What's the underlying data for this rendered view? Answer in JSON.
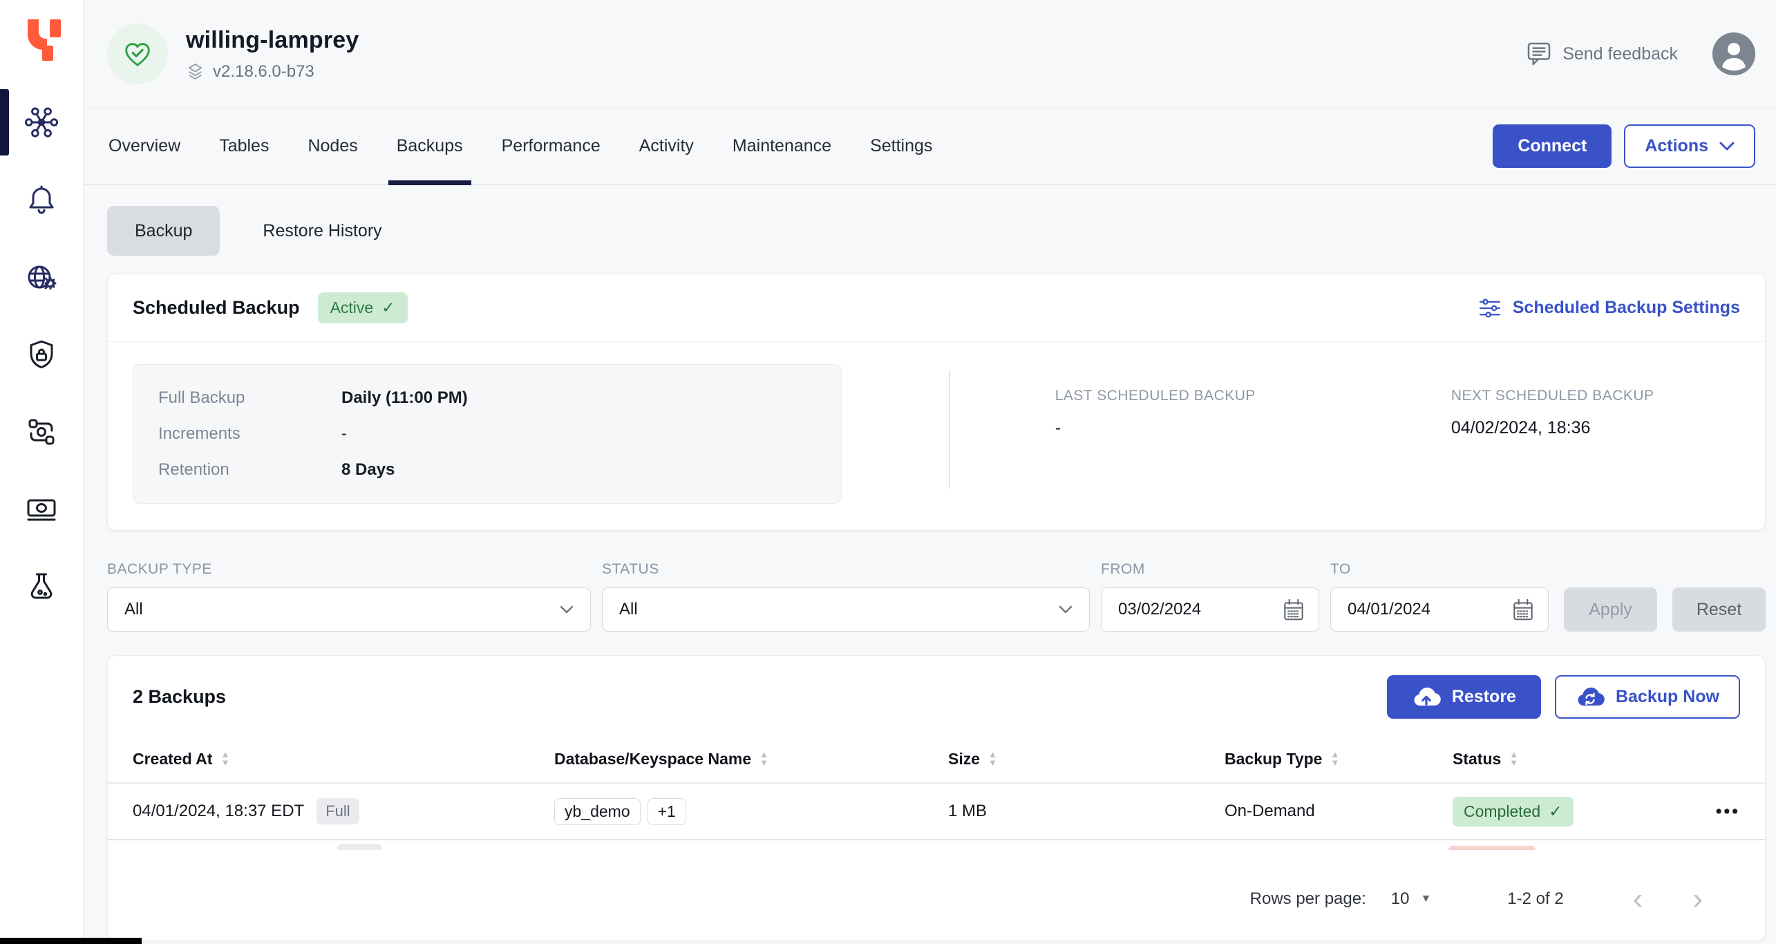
{
  "colors": {
    "accent_blue": "#3A52C8",
    "nav_navy": "#262B63",
    "logo_orange": "#FF5A3C",
    "success_bg": "#CDEBD3",
    "success_text": "#2B7A43",
    "page_bg": "#F6F8FA"
  },
  "header": {
    "cluster_name": "willing-lamprey",
    "version": "v2.18.6.0-b73",
    "send_feedback_label": "Send feedback"
  },
  "toolbar": {
    "connect_label": "Connect",
    "actions_label": "Actions"
  },
  "tabs": {
    "items": [
      "Overview",
      "Tables",
      "Nodes",
      "Backups",
      "Performance",
      "Activity",
      "Maintenance",
      "Settings"
    ],
    "active": "Backups"
  },
  "subtabs": {
    "items": [
      "Backup",
      "Restore History"
    ],
    "active": "Backup"
  },
  "scheduled": {
    "title": "Scheduled Backup",
    "status_label": "Active",
    "settings_label": "Scheduled Backup Settings",
    "details": [
      {
        "label": "Full Backup",
        "value": "Daily (11:00 PM)"
      },
      {
        "label": "Increments",
        "value": "-"
      },
      {
        "label": "Retention",
        "value": "8 Days"
      }
    ],
    "last": {
      "label": "LAST SCHEDULED BACKUP",
      "value": "-"
    },
    "next": {
      "label": "NEXT SCHEDULED BACKUP",
      "value": "04/02/2024, 18:36"
    }
  },
  "filters": {
    "backup_type": {
      "label": "BACKUP TYPE",
      "value": "All"
    },
    "status": {
      "label": "STATUS",
      "value": "All"
    },
    "from": {
      "label": "FROM",
      "value": "03/02/2024"
    },
    "to": {
      "label": "TO",
      "value": "04/01/2024"
    },
    "apply_label": "Apply",
    "reset_label": "Reset"
  },
  "backups": {
    "title": "2 Backups",
    "restore_label": "Restore",
    "backup_now_label": "Backup Now",
    "columns": [
      "Created At",
      "Database/Keyspace Name",
      "Size",
      "Backup Type",
      "Status"
    ],
    "rows": [
      {
        "created_at": "04/01/2024, 18:37 EDT",
        "type_badge": "Full",
        "keyspace": "yb_demo",
        "keyspace_more": "+1",
        "size": "1 MB",
        "backup_type": "On-Demand",
        "status": "Completed"
      }
    ],
    "pagination": {
      "label": "Rows per page:",
      "value": "10",
      "range": "1-2 of 2"
    }
  }
}
